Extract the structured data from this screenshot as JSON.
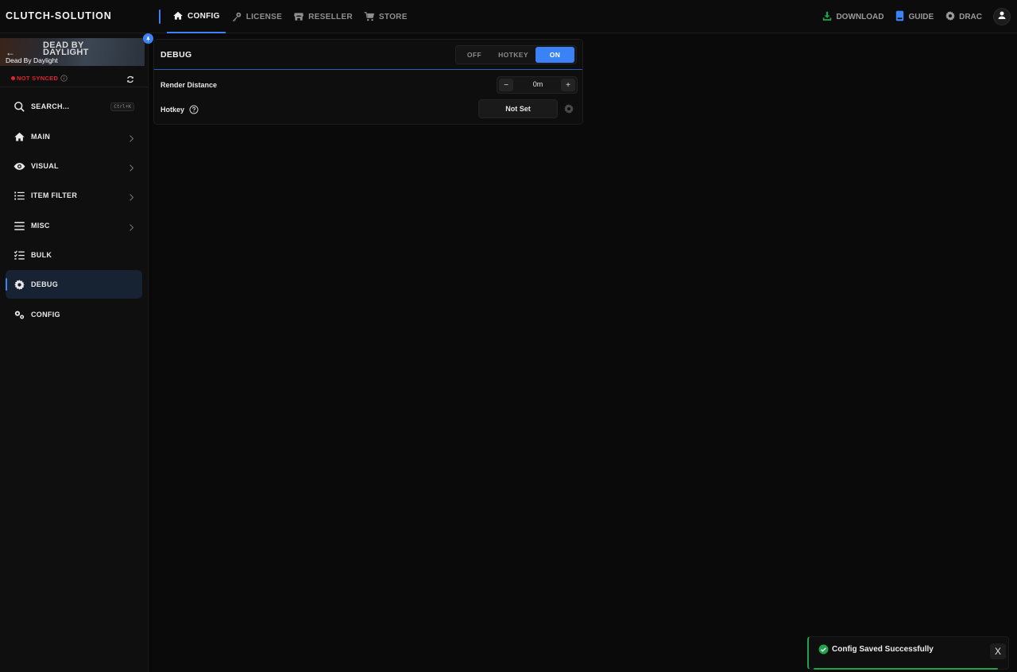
{
  "brand": "CLUTCH-SOLUTION",
  "nav": {
    "items": [
      {
        "label": "CONFIG",
        "icon": "home-icon",
        "active": true
      },
      {
        "label": "LICENSE",
        "icon": "key-icon"
      },
      {
        "label": "RESELLER",
        "icon": "store-icon"
      },
      {
        "label": "STORE",
        "icon": "cart-icon"
      }
    ]
  },
  "top_right": {
    "download": "DOWNLOAD",
    "guide": "GUIDE",
    "user": "DRAC"
  },
  "game": {
    "banner_title": "DEAD BY DAYLIGHT",
    "name": "Dead By Daylight",
    "sync_status": "NOT SYNCED"
  },
  "sidebar": {
    "search_label": "SEARCH...",
    "search_shortcut": "Ctrl+K",
    "items": [
      {
        "label": "MAIN",
        "icon": "home-icon"
      },
      {
        "label": "VISUAL",
        "icon": "eye-icon"
      },
      {
        "label": "ITEM FILTER",
        "icon": "list-icon"
      },
      {
        "label": "MISC",
        "icon": "menu-icon"
      },
      {
        "label": "BULK",
        "icon": "checklist-icon"
      },
      {
        "label": "DEBUG",
        "icon": "gear-icon",
        "active": true
      },
      {
        "label": "CONFIG",
        "icon": "gears-icon"
      }
    ]
  },
  "panel": {
    "title": "DEBUG",
    "modes": [
      "OFF",
      "HOTKEY",
      "ON"
    ],
    "selected_mode": "ON",
    "render_distance_label": "Render Distance",
    "render_distance_value": "0m",
    "hotkey_label": "Hotkey",
    "hotkey_value": "Not Set"
  },
  "toast": {
    "message": "Config Saved Successfully",
    "close": "X"
  },
  "colors": {
    "accent": "#3b82f6",
    "danger": "#e0262d",
    "success": "#22a24a",
    "download": "#22a24a",
    "guide": "#3b82f6"
  }
}
